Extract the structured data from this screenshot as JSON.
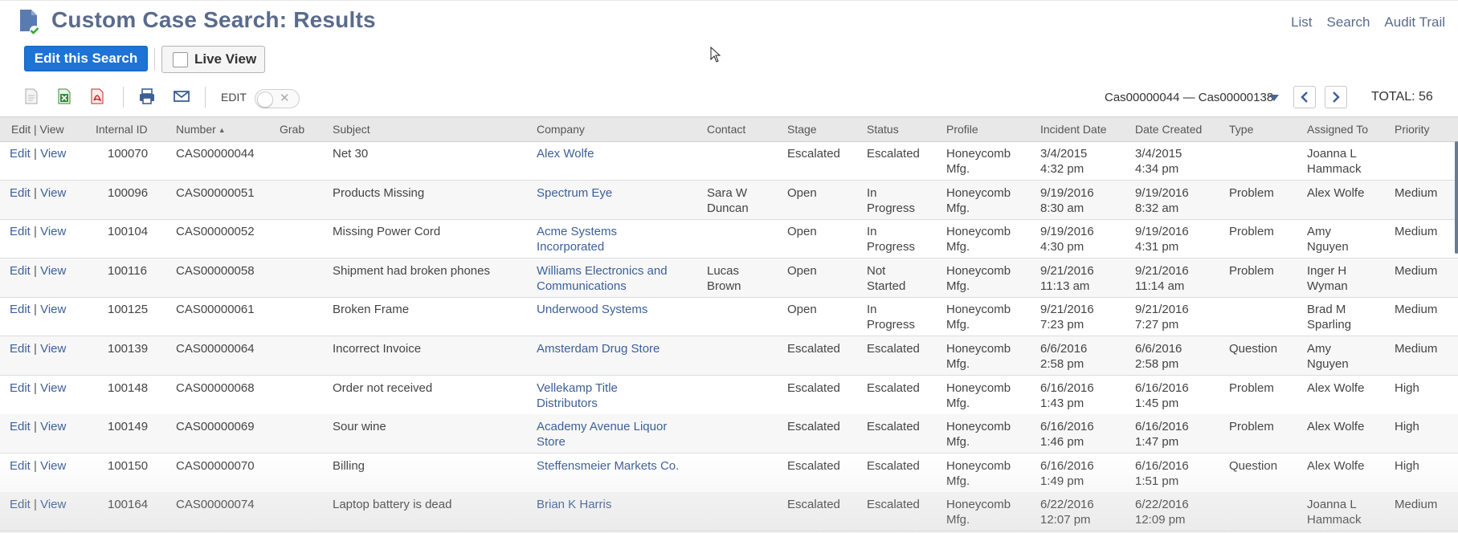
{
  "header": {
    "title": "Custom Case Search: Results",
    "links": [
      "List",
      "Search",
      "Audit Trail"
    ]
  },
  "buttons": {
    "edit_search": "Edit this Search",
    "live_view": "Live View"
  },
  "toolbar": {
    "icons": [
      "new-document-icon",
      "export-excel-icon",
      "export-pdf-icon",
      "print-icon",
      "email-icon"
    ],
    "edit_label": "EDIT",
    "edit_toggle_on": false,
    "range": "Cas00000044 — Cas00000138",
    "total": "TOTAL: 56"
  },
  "colors": {
    "title": "#5a6b8c",
    "primary_button": "#1d73d6",
    "link": "#3c5f99"
  },
  "table": {
    "columns": [
      "Edit | View",
      "Internal ID",
      "Number",
      "Grab",
      "Subject",
      "Company",
      "Contact",
      "Stage",
      "Status",
      "Profile",
      "Incident Date",
      "Date Created",
      "Type",
      "Assigned To",
      "Priority"
    ],
    "sort_column": "Number",
    "rows": [
      {
        "edit": "Edit",
        "view": "View",
        "id": "100070",
        "number": "CAS00000044",
        "subject": "Net 30",
        "company": [
          "Alex Wolfe"
        ],
        "contact": [],
        "stage": "Escalated",
        "status": [
          "Escalated"
        ],
        "profile": [
          "Honeycomb",
          "Mfg."
        ],
        "incident": [
          "3/4/2015",
          "4:32 pm"
        ],
        "created": [
          "3/4/2015",
          "4:34 pm"
        ],
        "type": "",
        "assigned": [
          "Joanna L",
          "Hammack"
        ],
        "priority": ""
      },
      {
        "edit": "Edit",
        "view": "View",
        "id": "100096",
        "number": "CAS00000051",
        "subject": "Products Missing",
        "company": [
          "Spectrum Eye"
        ],
        "contact": [
          "Sara W",
          "Duncan"
        ],
        "stage": "Open",
        "status": [
          "In",
          "Progress"
        ],
        "profile": [
          "Honeycomb",
          "Mfg."
        ],
        "incident": [
          "9/19/2016",
          "8:30 am"
        ],
        "created": [
          "9/19/2016",
          "8:32 am"
        ],
        "type": "Problem",
        "assigned": [
          "Alex Wolfe"
        ],
        "priority": "Medium"
      },
      {
        "edit": "Edit",
        "view": "View",
        "id": "100104",
        "number": "CAS00000052",
        "subject": "Missing Power Cord",
        "company": [
          "Acme Systems",
          "Incorporated"
        ],
        "contact": [],
        "stage": "Open",
        "status": [
          "In",
          "Progress"
        ],
        "profile": [
          "Honeycomb",
          "Mfg."
        ],
        "incident": [
          "9/19/2016",
          "4:30 pm"
        ],
        "created": [
          "9/19/2016",
          "4:31 pm"
        ],
        "type": "Problem",
        "assigned": [
          "Amy",
          "Nguyen"
        ],
        "priority": "Medium"
      },
      {
        "edit": "Edit",
        "view": "View",
        "id": "100116",
        "number": "CAS00000058",
        "subject": "Shipment had broken phones",
        "company": [
          "Williams Electronics and",
          "Communications"
        ],
        "contact": [
          "Lucas",
          "Brown"
        ],
        "stage": "Open",
        "status": [
          "Not",
          "Started"
        ],
        "profile": [
          "Honeycomb",
          "Mfg."
        ],
        "incident": [
          "9/21/2016",
          "11:13 am"
        ],
        "created": [
          "9/21/2016",
          "11:14 am"
        ],
        "type": "Problem",
        "assigned": [
          "Inger H",
          "Wyman"
        ],
        "priority": "Medium"
      },
      {
        "edit": "Edit",
        "view": "View",
        "id": "100125",
        "number": "CAS00000061",
        "subject": "Broken Frame",
        "company": [
          "Underwood Systems"
        ],
        "contact": [],
        "stage": "Open",
        "status": [
          "In",
          "Progress"
        ],
        "profile": [
          "Honeycomb",
          "Mfg."
        ],
        "incident": [
          "9/21/2016",
          "7:23 pm"
        ],
        "created": [
          "9/21/2016",
          "7:27 pm"
        ],
        "type": "",
        "assigned": [
          "Brad M",
          "Sparling"
        ],
        "priority": "Medium"
      },
      {
        "edit": "Edit",
        "view": "View",
        "id": "100139",
        "number": "CAS00000064",
        "subject": "Incorrect Invoice",
        "company": [
          "Amsterdam Drug Store"
        ],
        "contact": [],
        "stage": "Escalated",
        "status": [
          "Escalated"
        ],
        "profile": [
          "Honeycomb",
          "Mfg."
        ],
        "incident": [
          "6/6/2016",
          "2:58 pm"
        ],
        "created": [
          "6/6/2016",
          "2:58 pm"
        ],
        "type": "Question",
        "assigned": [
          "Amy",
          "Nguyen"
        ],
        "priority": "Medium"
      },
      {
        "edit": "Edit",
        "view": "View",
        "id": "100148",
        "number": "CAS00000068",
        "subject": "Order not received",
        "company": [
          "Vellekamp Title",
          "Distributors"
        ],
        "contact": [],
        "stage": "Escalated",
        "status": [
          "Escalated"
        ],
        "profile": [
          "Honeycomb",
          "Mfg."
        ],
        "incident": [
          "6/16/2016",
          "1:43 pm"
        ],
        "created": [
          "6/16/2016",
          "1:45 pm"
        ],
        "type": "Problem",
        "assigned": [
          "Alex Wolfe"
        ],
        "priority": "High"
      },
      {
        "edit": "Edit",
        "view": "View",
        "id": "100149",
        "number": "CAS00000069",
        "subject": "Sour wine",
        "company": [
          "Academy Avenue Liquor",
          "Store"
        ],
        "contact": [],
        "stage": "Escalated",
        "status": [
          "Escalated"
        ],
        "profile": [
          "Honeycomb",
          "Mfg."
        ],
        "incident": [
          "6/16/2016",
          "1:46 pm"
        ],
        "created": [
          "6/16/2016",
          "1:47 pm"
        ],
        "type": "Problem",
        "assigned": [
          "Alex Wolfe"
        ],
        "priority": "High"
      },
      {
        "edit": "Edit",
        "view": "View",
        "id": "100150",
        "number": "CAS00000070",
        "subject": "Billing",
        "company": [
          "Steffensmeier Markets Co."
        ],
        "contact": [],
        "stage": "Escalated",
        "status": [
          "Escalated"
        ],
        "profile": [
          "Honeycomb",
          "Mfg."
        ],
        "incident": [
          "6/16/2016",
          "1:49 pm"
        ],
        "created": [
          "6/16/2016",
          "1:51 pm"
        ],
        "type": "Question",
        "assigned": [
          "Alex Wolfe"
        ],
        "priority": "High"
      },
      {
        "edit": "Edit",
        "view": "View",
        "id": "100164",
        "number": "CAS00000074",
        "subject": "Laptop battery is dead",
        "company": [
          "Brian K Harris"
        ],
        "contact": [],
        "stage": "Escalated",
        "status": [
          "Escalated"
        ],
        "profile": [
          "Honeycomb",
          "Mfg."
        ],
        "incident": [
          "6/22/2016",
          "12:07 pm"
        ],
        "created": [
          "6/22/2016",
          "12:09 pm"
        ],
        "type": "",
        "assigned": [
          "Joanna L",
          "Hammack"
        ],
        "priority": "Medium"
      }
    ]
  }
}
